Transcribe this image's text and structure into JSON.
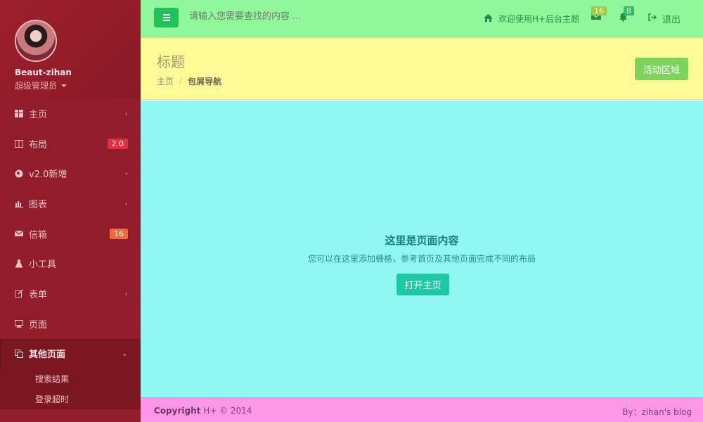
{
  "sidebar": {
    "username": "Beaut-zihan",
    "role": "超级管理员",
    "items": [
      {
        "label": "主页",
        "icon": "dashboard-icon",
        "chevron": "‹"
      },
      {
        "label": "布局",
        "icon": "columns-icon",
        "badge": "2.0"
      },
      {
        "label": "v2.0新增",
        "icon": "globe-icon",
        "chevron": "‹"
      },
      {
        "label": "图表",
        "icon": "bar-chart-icon",
        "chevron": "‹"
      },
      {
        "label": "信箱",
        "icon": "envelope-icon",
        "badge": "16"
      },
      {
        "label": "小工具",
        "icon": "flask-icon"
      },
      {
        "label": "表单",
        "icon": "edit-icon",
        "chevron": "‹"
      },
      {
        "label": "页面",
        "icon": "desktop-icon"
      },
      {
        "label": "其他页面",
        "icon": "files-icon",
        "chevron": "⌄"
      }
    ],
    "subitems": [
      "搜索结果",
      "登录超时"
    ]
  },
  "topbar": {
    "search_placeholder": "请输入您需要查找的内容 …",
    "welcome": "欢迎使用H+后台主题",
    "messages_count": "16",
    "alerts_count": "8",
    "logout": "退出"
  },
  "header": {
    "title": "标题",
    "breadcrumb_home": "主页",
    "breadcrumb_sep": "/",
    "breadcrumb_current": "包屑导航",
    "activity_button": "活动区域"
  },
  "content": {
    "title": "这里是页面内容",
    "description": "您可以在这里添加栅格，参考首页及其他页面完成不同的布局",
    "open_button": "打开主页"
  },
  "footer": {
    "copyright_bold": "Copyright",
    "copyright_rest": " H+ © 2014",
    "credit": "By：zihan's blog"
  },
  "colors": {
    "sidebar": "#901d29",
    "topbar": "#90f79a",
    "header": "#fffa96",
    "content": "#91f7f2",
    "footer": "#fd96e6"
  }
}
